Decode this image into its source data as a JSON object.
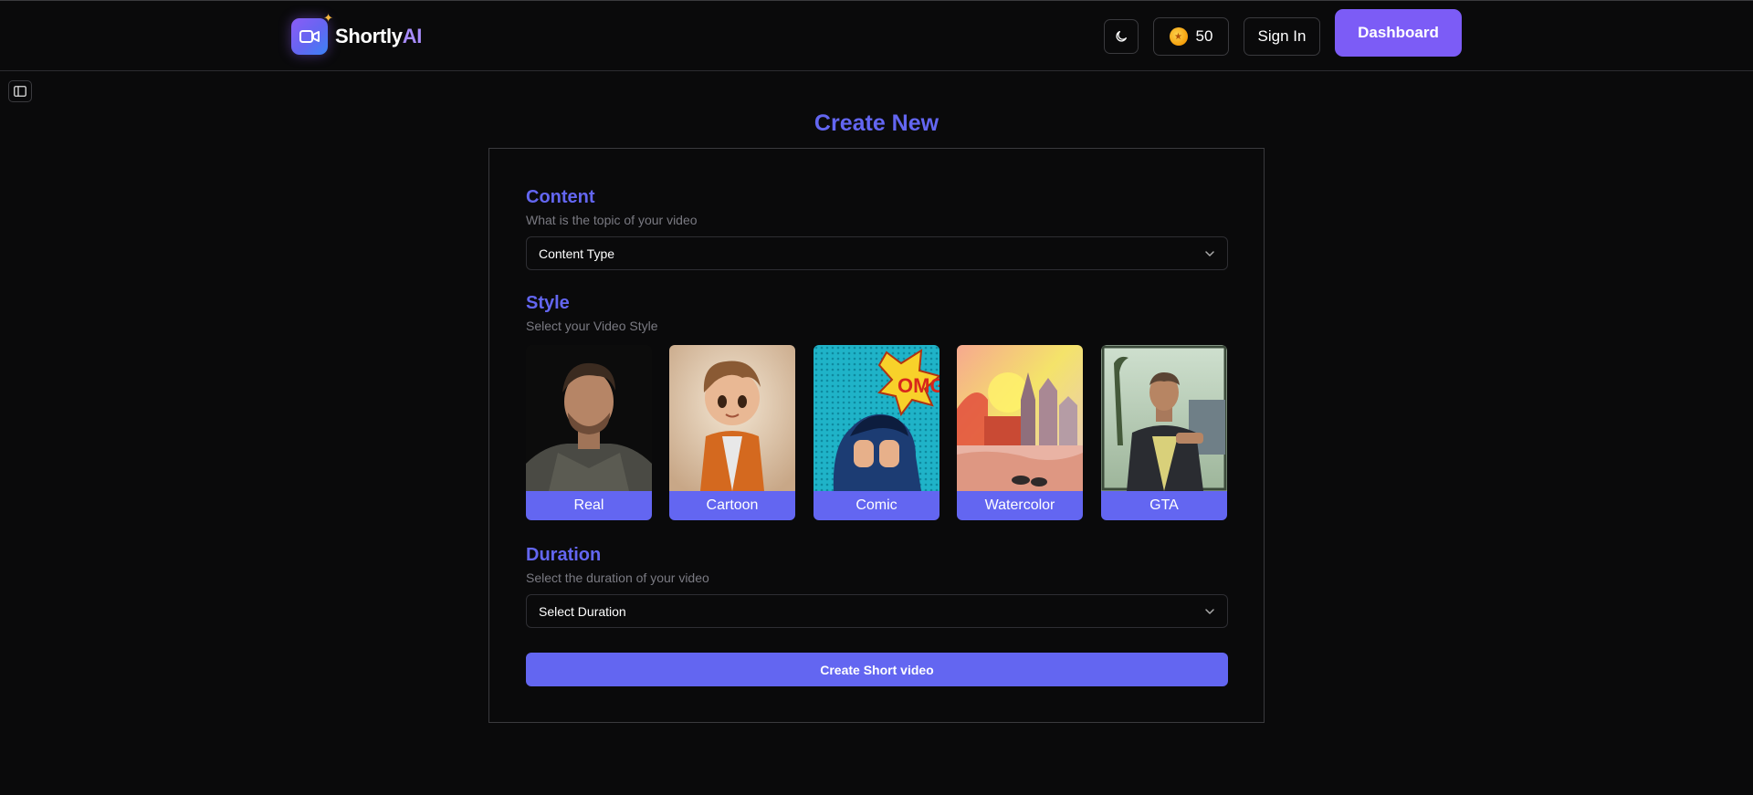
{
  "header": {
    "brand_main": "Shortly",
    "brand_accent": "AI",
    "coins": "50",
    "signin_label": "Sign In",
    "dashboard_label": "Dashboard"
  },
  "page": {
    "title": "Create New"
  },
  "content_section": {
    "title": "Content",
    "subtitle": "What is the topic of your video",
    "select_value": "Content Type"
  },
  "style_section": {
    "title": "Style",
    "subtitle": "Select your Video Style",
    "options": [
      {
        "label": "Real"
      },
      {
        "label": "Cartoon"
      },
      {
        "label": "Comic"
      },
      {
        "label": "Watercolor"
      },
      {
        "label": "GTA"
      }
    ]
  },
  "duration_section": {
    "title": "Duration",
    "subtitle": "Select the duration of your video",
    "select_value": "Select Duration"
  },
  "create_button_label": "Create Short video",
  "colors": {
    "accent": "#6366f1",
    "dashboard": "#7c5cf6",
    "background": "#0a0a0b"
  },
  "icons": [
    "video-icon",
    "sparkle-icon",
    "moon-icon",
    "coin-icon",
    "sidebar-panel-icon",
    "chevron-down-icon"
  ]
}
